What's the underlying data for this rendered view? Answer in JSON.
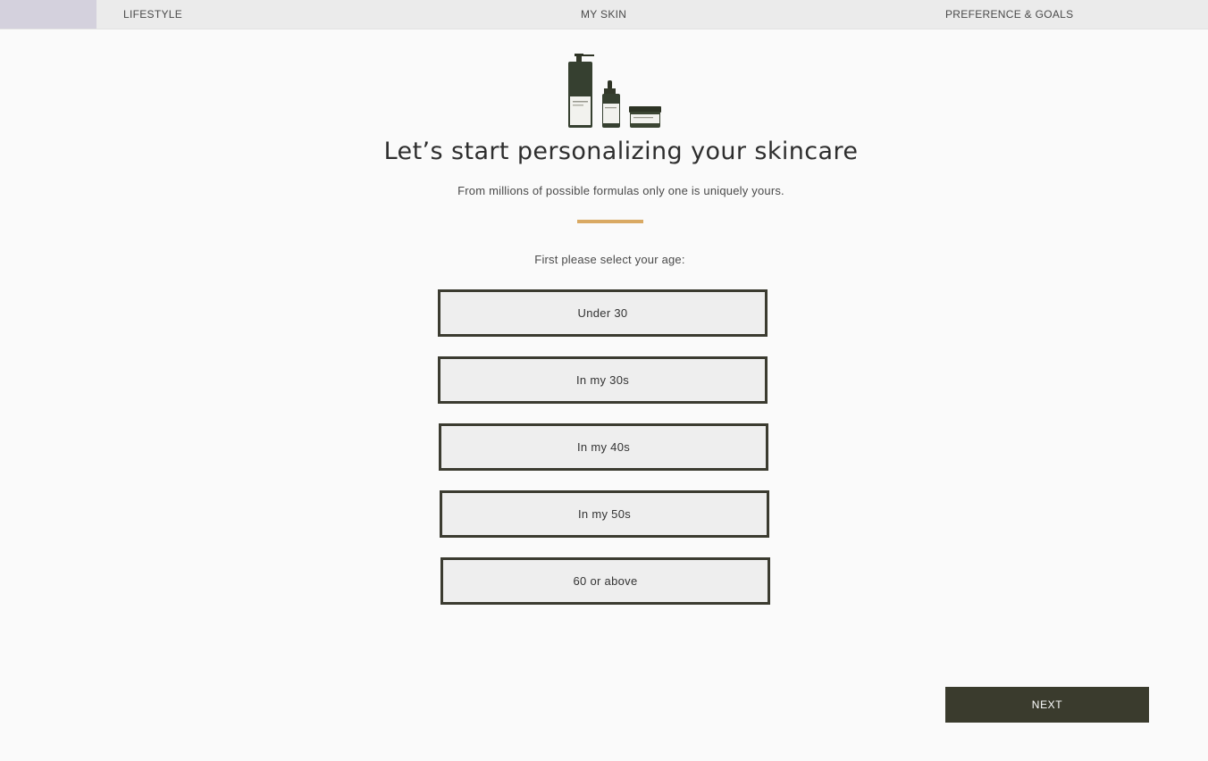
{
  "progress": {
    "steps": [
      {
        "label": "LIFESTYLE"
      },
      {
        "label": "MY SKIN"
      },
      {
        "label": "PREFERENCE & GOALS"
      }
    ],
    "fill_color": "#d4d1dd"
  },
  "hero": {
    "image_icon": "skincare-products-icon",
    "title": "Let’s start personalizing your skincare",
    "subtitle": "From millions of possible formulas only one is uniquely yours.",
    "accent_color": "#d9a963"
  },
  "question": {
    "prompt": "First please select your age:",
    "options": [
      {
        "label": "Under 30"
      },
      {
        "label": "In my 30s"
      },
      {
        "label": "In my 40s"
      },
      {
        "label": "In my 50s"
      },
      {
        "label": "60 or above"
      }
    ]
  },
  "footer": {
    "next_label": "NEXT",
    "button_color": "#3a3b2d"
  }
}
